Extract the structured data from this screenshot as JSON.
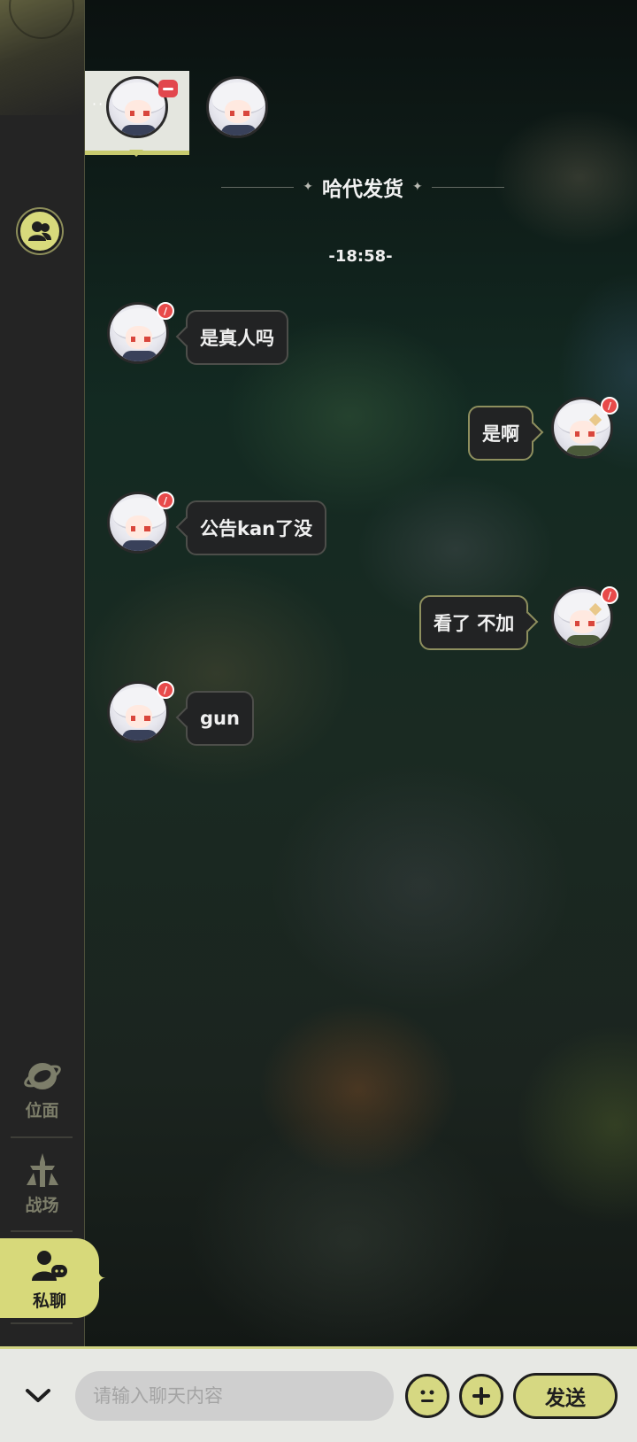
{
  "chat": {
    "title": "哈代发货",
    "time": "-18:58-",
    "messages": [
      {
        "side": "left",
        "text": "是真人吗"
      },
      {
        "side": "right",
        "text": "是啊"
      },
      {
        "side": "left",
        "text": "公告kan了没"
      },
      {
        "side": "right",
        "text": "看了 不加"
      },
      {
        "side": "left",
        "text": "gun"
      }
    ]
  },
  "sidebar": {
    "items": [
      {
        "label": "位面",
        "icon": "plane-icon"
      },
      {
        "label": "战场",
        "icon": "battlefield-icon"
      },
      {
        "label": "私聊",
        "icon": "private-chat-icon",
        "active": true
      }
    ]
  },
  "input": {
    "placeholder": "请输入聊天内容",
    "send_label": "发送"
  },
  "colors": {
    "accent": "#d6d882",
    "badge": "#e84a4a",
    "sidebar": "#242424"
  }
}
